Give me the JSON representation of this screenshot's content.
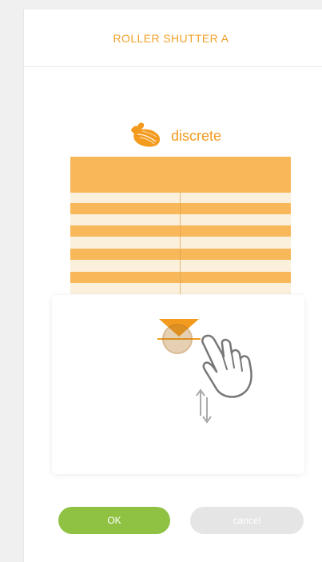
{
  "header": {
    "title": "ROLLER SHUTTER A"
  },
  "mode": {
    "label": "discrete",
    "icon": "feather-icon",
    "color": "#f39b1f"
  },
  "shutter": {
    "fill_color": "#f8b85a",
    "background_color": "#fbf0dc"
  },
  "controls": {
    "down_icon": "triangle-down-icon",
    "pointer_icon": "hand-pointer-icon",
    "arrows_icon": "up-down-arrows-icon"
  },
  "buttons": {
    "ok_label": "OK",
    "cancel_label": "cancel",
    "ok_color": "#8fc243",
    "cancel_color": "#e5e5e5"
  }
}
